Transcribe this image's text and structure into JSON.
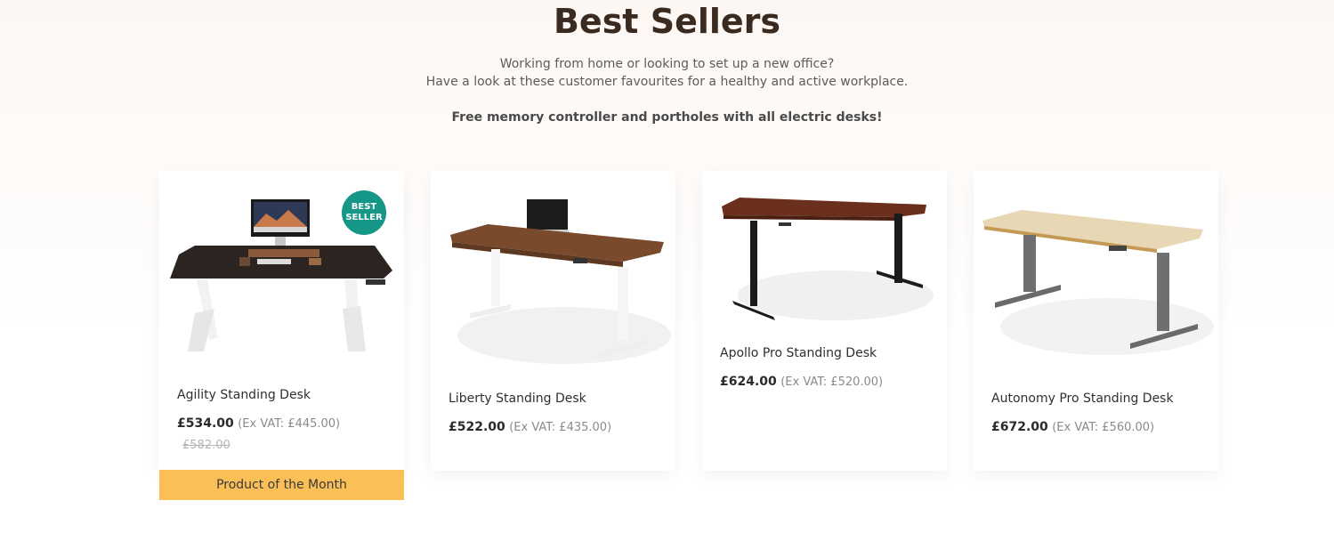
{
  "section": {
    "title": "Best Sellers",
    "subtitle_line1": "Working from home or looking to set up a new office?",
    "subtitle_line2": "Have a look at these customer favourites for a healthy and active workplace.",
    "promo": "Free memory controller and portholes with all electric desks!"
  },
  "products": [
    {
      "name": "Agility Standing Desk",
      "price": "£534.00",
      "ex_vat": "(Ex VAT: £445.00)",
      "old_price": "£582.00",
      "badge_line1": "BEST",
      "badge_line2": "SELLER",
      "ribbon": "Product of the Month",
      "desktop_color": "#2b2420",
      "frame_color": "#f2f2f2"
    },
    {
      "name": "Liberty Standing Desk",
      "price": "£522.00",
      "ex_vat": "(Ex VAT: £435.00)",
      "desktop_color": "#7a4a2c",
      "frame_color": "#f5f5f5"
    },
    {
      "name": "Apollo Pro Standing Desk",
      "price": "£624.00",
      "ex_vat": "(Ex VAT: £520.00)",
      "desktop_color": "#6b2f1d",
      "frame_color": "#1b1b1b"
    },
    {
      "name": "Autonomy Pro Standing Desk",
      "price": "£672.00",
      "ex_vat": "(Ex VAT: £560.00)",
      "desktop_color": "#e8d7b4",
      "frame_color": "#6f6f6f"
    }
  ],
  "colors": {
    "badge": "#159686",
    "ribbon": "#fbbf57",
    "title": "#3a2a20"
  }
}
